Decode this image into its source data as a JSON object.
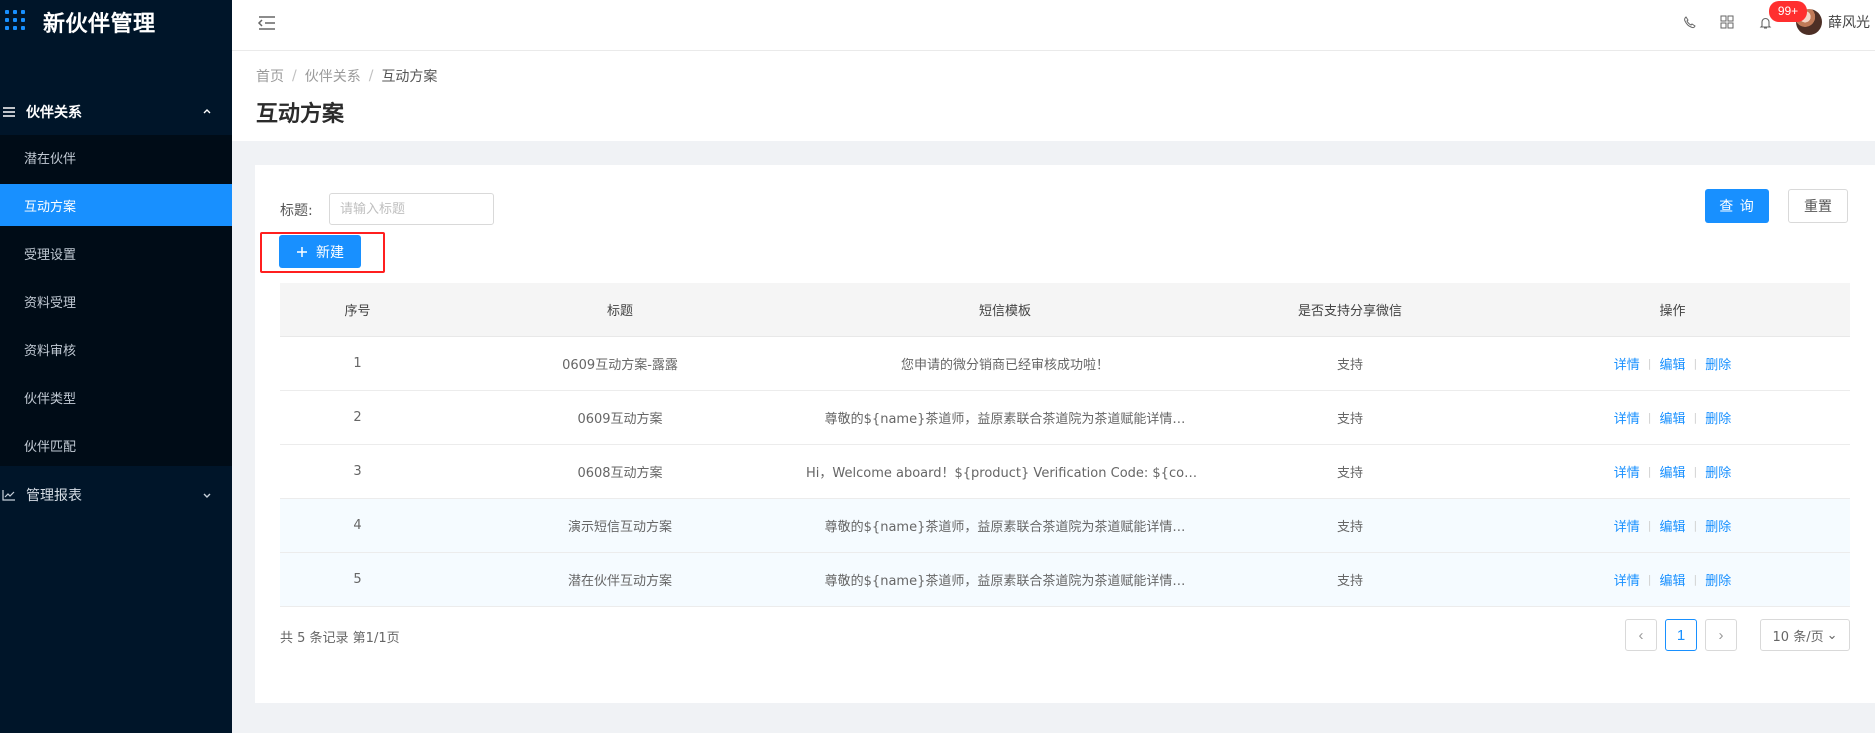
{
  "app": {
    "name": "新伙伴管理"
  },
  "sidebar": {
    "groups": [
      {
        "label": "伙伴关系",
        "items": [
          {
            "label": "潜在伙伴"
          },
          {
            "label": "互动方案"
          },
          {
            "label": "受理设置"
          },
          {
            "label": "资料受理"
          },
          {
            "label": "资料审核"
          },
          {
            "label": "伙伴类型"
          },
          {
            "label": "伙伴匹配"
          }
        ]
      },
      {
        "label": "管理报表"
      }
    ]
  },
  "topbar": {
    "notification_count": "99+",
    "user_name": "薛风光"
  },
  "breadcrumb": [
    "首页",
    "伙伴关系",
    "互动方案"
  ],
  "page": {
    "title": "互动方案"
  },
  "filters": {
    "title_label": "标题:",
    "title_placeholder": "请输入标题",
    "query_label": "查 询",
    "reset_label": "重置",
    "new_label": "新建"
  },
  "table": {
    "columns": [
      "序号",
      "标题",
      "短信模板",
      "是否支持分享微信",
      "操作"
    ],
    "rows": [
      [
        "1",
        "0609互动方案-露露",
        "您申请的微分销商已经审核成功啦！",
        "支持"
      ],
      [
        "2",
        "0609互动方案",
        "尊敬的${name}茶道师，益原素联合茶道院为茶道赋能详情…",
        "支持"
      ],
      [
        "3",
        "0608互动方案",
        "Hi，Welcome aboard！${product} Verification Code: ${cod…",
        "支持"
      ],
      [
        "4",
        "演示短信互动方案",
        "尊敬的${name}茶道师，益原素联合茶道院为茶道赋能详情…",
        "支持"
      ],
      [
        "5",
        "潜在伙伴互动方案",
        "尊敬的${name}茶道师，益原素联合茶道院为茶道赋能详情…",
        "支持"
      ]
    ],
    "actions": [
      "详情",
      "编辑",
      "删除"
    ]
  },
  "pagination": {
    "summary": "共 5 条记录 第1/1页",
    "current_page": "1",
    "page_size": "10 条/页"
  },
  "colors": {
    "sidebar_bg": "#001529",
    "primary": "#1890ff",
    "highlight_border": "#ff1f1f",
    "badge": "#ff2f2f"
  }
}
